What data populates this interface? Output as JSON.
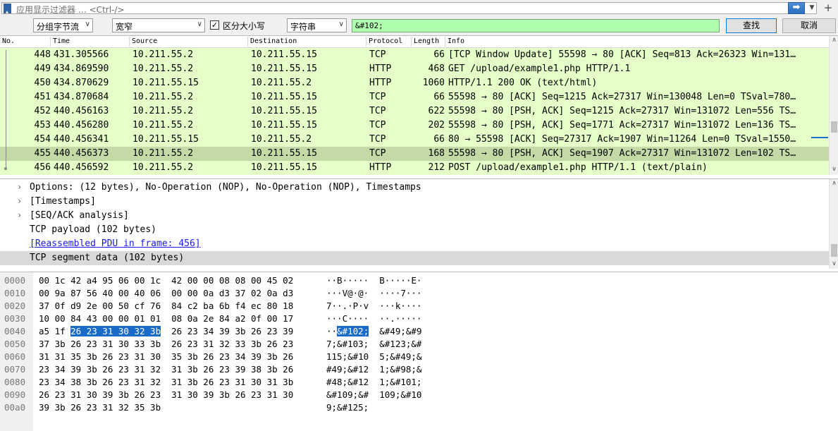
{
  "filter_bar": {
    "placeholder": "应用显示过滤器 … <Ctrl-/>",
    "apply_icon": "arrow-right-icon",
    "bookmark_icon": "bookmark-icon"
  },
  "find_bar": {
    "search_in": "分组字节流",
    "char_width": "宽窄",
    "case_sensitive_label": "区分大小写",
    "case_sensitive_checked": true,
    "search_type": "字符串",
    "search_value": "&#102;",
    "find_label": "查找",
    "cancel_label": "取消"
  },
  "packet_list": {
    "columns": [
      "No.",
      "Time",
      "Source",
      "Destination",
      "Protocol",
      "Length",
      "Info"
    ],
    "rows": [
      {
        "no": "448",
        "time": "431.305566",
        "src": "10.211.55.2",
        "dst": "10.211.55.15",
        "proto": "TCP",
        "len": "66",
        "info": "[TCP Window Update] 55598 → 80 [ACK] Seq=813 Ack=26323 Win=131…"
      },
      {
        "no": "449",
        "time": "434.869590",
        "src": "10.211.55.2",
        "dst": "10.211.55.15",
        "proto": "HTTP",
        "len": "468",
        "info": "GET /upload/example1.php HTTP/1.1"
      },
      {
        "no": "450",
        "time": "434.870629",
        "src": "10.211.55.15",
        "dst": "10.211.55.2",
        "proto": "HTTP",
        "len": "1060",
        "info": "HTTP/1.1 200 OK  (text/html)"
      },
      {
        "no": "451",
        "time": "434.870684",
        "src": "10.211.55.2",
        "dst": "10.211.55.15",
        "proto": "TCP",
        "len": "66",
        "info": "55598 → 80 [ACK] Seq=1215 Ack=27317 Win=130048 Len=0 TSval=780…"
      },
      {
        "no": "452",
        "time": "440.456163",
        "src": "10.211.55.2",
        "dst": "10.211.55.15",
        "proto": "TCP",
        "len": "622",
        "info": "55598 → 80 [PSH, ACK] Seq=1215 Ack=27317 Win=131072 Len=556 TS…"
      },
      {
        "no": "453",
        "time": "440.456280",
        "src": "10.211.55.2",
        "dst": "10.211.55.15",
        "proto": "TCP",
        "len": "202",
        "info": "55598 → 80 [PSH, ACK] Seq=1771 Ack=27317 Win=131072 Len=136 TS…"
      },
      {
        "no": "454",
        "time": "440.456341",
        "src": "10.211.55.15",
        "dst": "10.211.55.2",
        "proto": "TCP",
        "len": "66",
        "info": "80 → 55598 [ACK] Seq=27317 Ack=1907 Win=11264 Len=0 TSval=1550…"
      },
      {
        "no": "455",
        "time": "440.456373",
        "src": "10.211.55.2",
        "dst": "10.211.55.15",
        "proto": "TCP",
        "len": "168",
        "info": "55598 → 80 [PSH, ACK] Seq=1907 Ack=27317 Win=131072 Len=102 TS…"
      },
      {
        "no": "456",
        "time": "440.456592",
        "src": "10.211.55.2",
        "dst": "10.211.55.15",
        "proto": "HTTP",
        "len": "212",
        "info": "POST /upload/example1.php HTTP/1.1  (text/plain)"
      }
    ],
    "selected_no": "455"
  },
  "details": {
    "items": [
      {
        "expander": "›",
        "label": "Options: (12 bytes), No-Operation (NOP), No-Operation (NOP), Timestamps"
      },
      {
        "expander": "›",
        "label": "[Timestamps]"
      },
      {
        "expander": "›",
        "label": "[SEQ/ACK analysis]"
      },
      {
        "expander": "",
        "label": "TCP payload (102 bytes)"
      },
      {
        "expander": "",
        "label": "[Reassembled PDU in frame: 456]"
      },
      {
        "expander": "",
        "label": "TCP segment data (102 bytes)"
      }
    ]
  },
  "bytes": {
    "rows": [
      {
        "offset": "0000",
        "hex": "00 1c 42 a4 95 06 00 1c  42 00 00 08 08 00 45 02",
        "ascii": "··B·····  B·····E·"
      },
      {
        "offset": "0010",
        "hex": "00 9a 87 56 40 00 40 06  00 00 0a d3 37 02 0a d3",
        "ascii": "···V@·@·  ····7···"
      },
      {
        "offset": "0020",
        "hex": "37 0f d9 2e 00 50 cf 76  84 c2 ba 6b f4 ec 80 18",
        "ascii": "7··.·P·v  ···k····"
      },
      {
        "offset": "0030",
        "hex": "10 00 84 43 00 00 01 01  08 0a 2e 84 a2 0f 00 17",
        "ascii": "···C····  ··.·····"
      },
      {
        "offset": "0040",
        "hex_pre": "a5 1f ",
        "hex_hl": "26 23 31 30 32 3b",
        "hex_post": "  26 23 34 39 3b 26 23 39",
        "ascii_pre": "··",
        "ascii_hl": "&#102;",
        "ascii_post": "  &#49;&#9"
      },
      {
        "offset": "0050",
        "hex": "37 3b 26 23 31 30 33 3b  26 23 31 32 33 3b 26 23",
        "ascii": "7;&#103;  &#123;&#"
      },
      {
        "offset": "0060",
        "hex": "31 31 35 3b 26 23 31 30  35 3b 26 23 34 39 3b 26",
        "ascii": "115;&#10  5;&#49;&"
      },
      {
        "offset": "0070",
        "hex": "23 34 39 3b 26 23 31 32  31 3b 26 23 39 38 3b 26",
        "ascii": "#49;&#12  1;&#98;&"
      },
      {
        "offset": "0080",
        "hex": "23 34 38 3b 26 23 31 32  31 3b 26 23 31 30 31 3b",
        "ascii": "#48;&#12  1;&#101;"
      },
      {
        "offset": "0090",
        "hex": "26 23 31 30 39 3b 26 23  31 30 39 3b 26 23 31 30",
        "ascii": "&#109;&#  109;&#10"
      },
      {
        "offset": "00a0",
        "hex": "39 3b 26 23 31 32 35 3b",
        "ascii": "9;&#125;"
      }
    ]
  },
  "colors": {
    "row_bg": "#e4ffc7",
    "row_selected_bg": "#c3d9a6",
    "search_bg": "#afffaf",
    "byte_highlight": "#1a6ac8"
  }
}
